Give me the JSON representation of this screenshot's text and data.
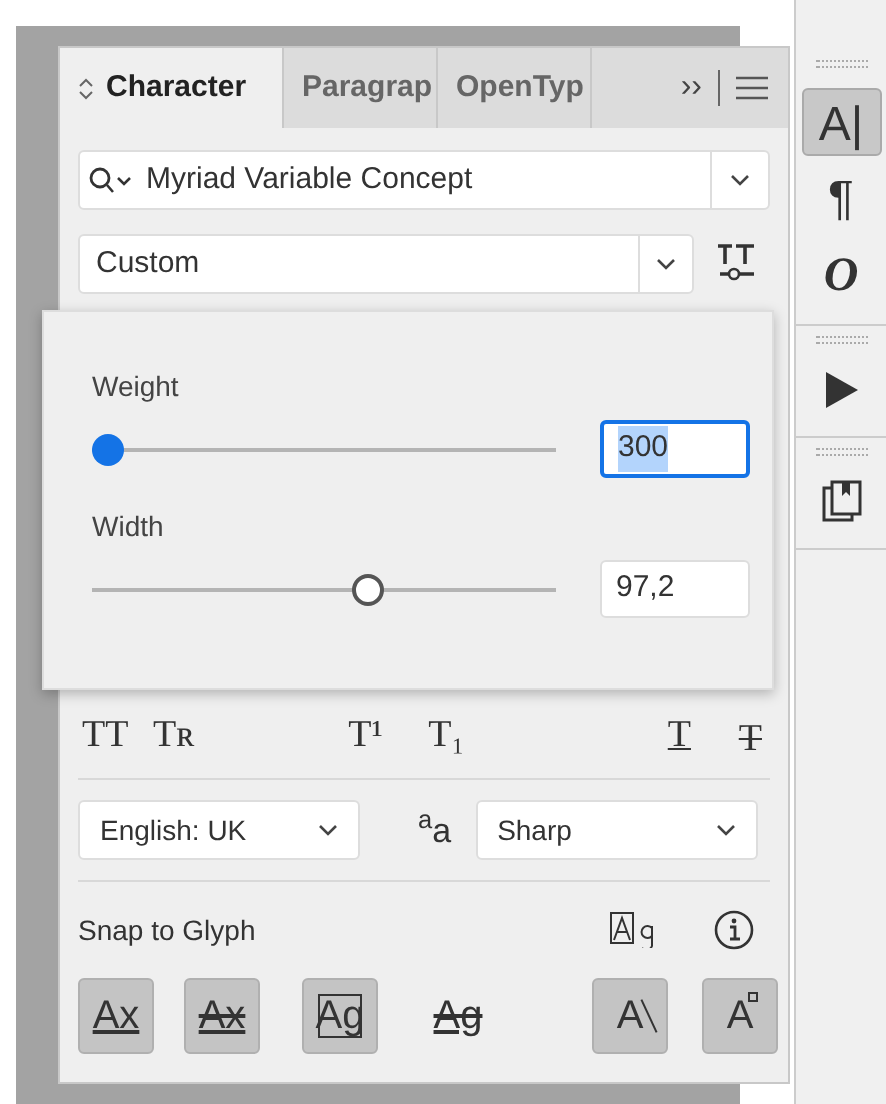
{
  "tabs": [
    {
      "label": "Character",
      "selected": true
    },
    {
      "label": "Paragrap",
      "selected": false
    },
    {
      "label": "OpenTyp",
      "selected": false
    }
  ],
  "tab_overflow": "››",
  "font_family": {
    "value": "Myriad Variable Concept"
  },
  "font_style": {
    "value": "Custom"
  },
  "variable_axes": [
    {
      "label": "Weight",
      "value": "300",
      "level": 0,
      "focused": true
    },
    {
      "label": "Width",
      "value": "97,2",
      "level": 0.6,
      "focused": false
    }
  ],
  "style_buttons": [
    {
      "label": "TT",
      "kind": "plain"
    },
    {
      "label": "Tʀ",
      "kind": "plain"
    },
    {
      "label": "T¹",
      "kind": "plain"
    },
    {
      "label": "T₁",
      "kind": "plain"
    },
    {
      "label": "T",
      "kind": "underline"
    },
    {
      "label": "T",
      "kind": "strike"
    }
  ],
  "language": {
    "value": "English: UK"
  },
  "antialias": {
    "icon": "$^{a}$a",
    "value": "Sharp"
  },
  "snap_to_glyph": {
    "label": "Snap to Glyph"
  },
  "snap_buttons": [
    {
      "label": "Ax",
      "kind": "baseline",
      "selected": true
    },
    {
      "label": "Ax",
      "kind": "xheight",
      "selected": true
    },
    {
      "label": "Ag",
      "kind": "bounds",
      "selected": true
    },
    {
      "label": "Ag",
      "kind": "proximity",
      "selected": false
    },
    {
      "label": "A",
      "kind": "angular",
      "selected": true
    },
    {
      "label": "A",
      "kind": "anchor",
      "selected": true
    }
  ],
  "dock": [
    {
      "label": "A|",
      "kind": "character",
      "selected": true
    },
    {
      "label": "¶",
      "kind": "paragraph",
      "selected": false
    },
    {
      "label": "O",
      "kind": "opentype",
      "selected": false
    }
  ]
}
